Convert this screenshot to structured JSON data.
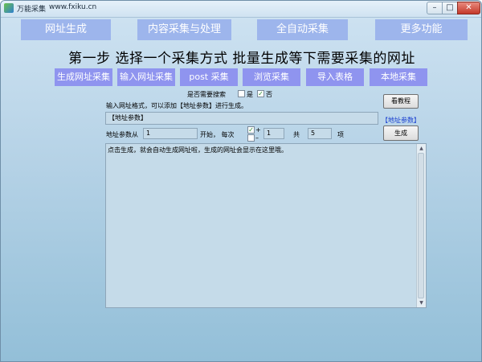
{
  "window": {
    "title": "万能采集",
    "url": "www.fxiku.cn",
    "min_symbol": "–",
    "max_symbol": "□",
    "close_symbol": "✕"
  },
  "nav_tabs": [
    {
      "label": "网址生成"
    },
    {
      "label": "内容采集与处理"
    },
    {
      "label": "全自动采集"
    },
    {
      "label": "更多功能"
    }
  ],
  "headline": "第一步  选择一个采集方式  批量生成等下需要采集的网址",
  "methods": [
    {
      "label": "生成网址采集"
    },
    {
      "label": "输入网址采集"
    },
    {
      "label": "post 采集"
    },
    {
      "label": "浏览采集"
    },
    {
      "label": "导入表格"
    },
    {
      "label": "本地采集"
    }
  ],
  "search_option": {
    "question": "是否需要搜索",
    "yes_label": "是",
    "no_label": "否",
    "checked_mark": "✓"
  },
  "tutorial_button": "看教程",
  "format_hint": "输入网址格式，可以添加【地址参数】进行生成。",
  "url_input_value": "【地址参数】",
  "param_link": "【地址参数】",
  "params": {
    "from_label": "地址参数从",
    "start_value": "1",
    "start_suffix": "开始，  每次",
    "plus_symbol": "+",
    "minus_symbol": "–",
    "step_value": "1",
    "total_label": "共",
    "count_value": "5",
    "items_label": "项"
  },
  "generate_button": "生成",
  "output_text": "点击生成，就会自动生成网址啦，生成的网址会显示在这里哦。",
  "scroll": {
    "up": "▲",
    "down": "▼"
  }
}
